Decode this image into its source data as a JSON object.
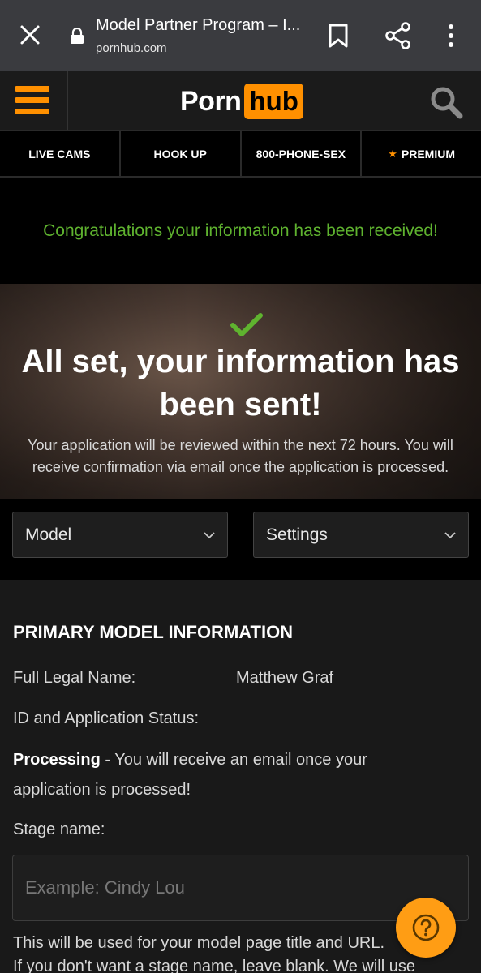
{
  "browser": {
    "title": "Model Partner Program – I...",
    "url": "pornhub.com"
  },
  "header": {
    "logo_part1": "Porn",
    "logo_part2": "hub"
  },
  "nav": {
    "items": [
      {
        "label": "LIVE CAMS"
      },
      {
        "label": "HOOK UP"
      },
      {
        "label": "800-PHONE-SEX"
      },
      {
        "label": "PREMIUM"
      }
    ]
  },
  "congrats": {
    "message": "Congratulations your information has been received!"
  },
  "hero": {
    "heading_line1": "All set, your information has",
    "heading_line2": "been sent!",
    "sub_line1": "Your application will be reviewed within the next 72 hours. You will",
    "sub_line2": "receive confirmation via email once the application is processed."
  },
  "selects": {
    "model": "Model",
    "settings": "Settings"
  },
  "form": {
    "section_title": "PRIMARY MODEL INFORMATION",
    "full_name_label": "Full Legal Name:",
    "full_name_value": "Matthew Graf",
    "id_status_label": "ID and Application Status:",
    "status_bold": "Processing",
    "status_rest_line1": " - You will receive an email once your",
    "status_line2": "application is processed!",
    "stage_name_label": "Stage name:",
    "stage_name_placeholder": "Example: Cindy Lou",
    "stage_name_value": "",
    "help_line1": "This will be used for your model page title and URL.",
    "help_line2": "If you don't want a stage name, leave blank. We will use"
  },
  "colors": {
    "accent": "#ff9000",
    "success": "#5fb32f",
    "header_bg": "#1b1b1b",
    "browser_bar_bg": "#3a3b3f"
  }
}
